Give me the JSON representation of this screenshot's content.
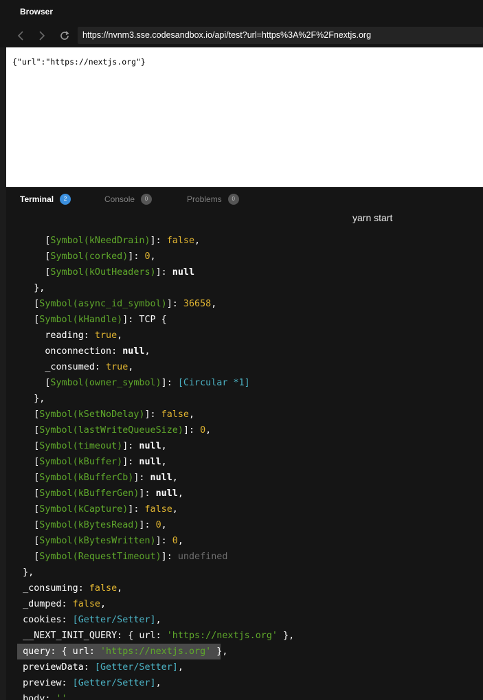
{
  "browser": {
    "title": "Browser",
    "url": "https://nvnm3.sse.codesandbox.io/api/test?url=https%3A%2F%2Fnextjs.org",
    "nav_icons": {
      "back": "arrow-left-icon",
      "forward": "arrow-right-icon",
      "refresh": "refresh-icon"
    }
  },
  "preview": {
    "content": "{\"url\":\"https://nextjs.org\"}"
  },
  "panel": {
    "tabs": [
      {
        "label": "Terminal",
        "badge": "2",
        "active": true
      },
      {
        "label": "Console",
        "badge": "0",
        "active": false
      },
      {
        "label": "Problems",
        "badge": "0",
        "active": false
      }
    ],
    "terminal_name": "yarn start"
  },
  "colors": {
    "symbol": "#5fa82b",
    "number": "#e1b531",
    "getter": "#4cb3c5",
    "undefined": "#6e6e6e",
    "badge_active": "#3b8fde"
  },
  "terminal": {
    "lines": [
      {
        "indent": 6,
        "tokens": [
          {
            "t": "[",
            "c": "plain"
          },
          {
            "t": "Symbol(kNeedDrain)",
            "c": "sym"
          },
          {
            "t": "]: ",
            "c": "plain"
          },
          {
            "t": "false",
            "c": "bool"
          },
          {
            "t": ",",
            "c": "plain"
          }
        ]
      },
      {
        "indent": 6,
        "tokens": [
          {
            "t": "[",
            "c": "plain"
          },
          {
            "t": "Symbol(corked)",
            "c": "sym"
          },
          {
            "t": "]: ",
            "c": "plain"
          },
          {
            "t": "0",
            "c": "num"
          },
          {
            "t": ",",
            "c": "plain"
          }
        ]
      },
      {
        "indent": 6,
        "tokens": [
          {
            "t": "[",
            "c": "plain"
          },
          {
            "t": "Symbol(kOutHeaders)",
            "c": "sym"
          },
          {
            "t": "]: ",
            "c": "plain"
          },
          {
            "t": "null",
            "c": "nul"
          }
        ]
      },
      {
        "indent": 4,
        "tokens": [
          {
            "t": "},",
            "c": "plain"
          }
        ]
      },
      {
        "indent": 4,
        "tokens": [
          {
            "t": "[",
            "c": "plain"
          },
          {
            "t": "Symbol(async_id_symbol)",
            "c": "sym"
          },
          {
            "t": "]: ",
            "c": "plain"
          },
          {
            "t": "36658",
            "c": "num"
          },
          {
            "t": ",",
            "c": "plain"
          }
        ]
      },
      {
        "indent": 4,
        "tokens": [
          {
            "t": "[",
            "c": "plain"
          },
          {
            "t": "Symbol(kHandle)",
            "c": "sym"
          },
          {
            "t": "]: TCP {",
            "c": "plain"
          }
        ]
      },
      {
        "indent": 6,
        "tokens": [
          {
            "t": "reading: ",
            "c": "plain"
          },
          {
            "t": "true",
            "c": "bool"
          },
          {
            "t": ",",
            "c": "plain"
          }
        ]
      },
      {
        "indent": 6,
        "tokens": [
          {
            "t": "onconnection: ",
            "c": "plain"
          },
          {
            "t": "null",
            "c": "nul"
          },
          {
            "t": ",",
            "c": "plain"
          }
        ]
      },
      {
        "indent": 6,
        "tokens": [
          {
            "t": "_consumed: ",
            "c": "plain"
          },
          {
            "t": "true",
            "c": "bool"
          },
          {
            "t": ",",
            "c": "plain"
          }
        ]
      },
      {
        "indent": 6,
        "tokens": [
          {
            "t": "[",
            "c": "plain"
          },
          {
            "t": "Symbol(owner_symbol)",
            "c": "sym"
          },
          {
            "t": "]: ",
            "c": "plain"
          },
          {
            "t": "[Circular *1]",
            "c": "cyan"
          }
        ]
      },
      {
        "indent": 4,
        "tokens": [
          {
            "t": "},",
            "c": "plain"
          }
        ]
      },
      {
        "indent": 4,
        "tokens": [
          {
            "t": "[",
            "c": "plain"
          },
          {
            "t": "Symbol(kSetNoDelay)",
            "c": "sym"
          },
          {
            "t": "]: ",
            "c": "plain"
          },
          {
            "t": "false",
            "c": "bool"
          },
          {
            "t": ",",
            "c": "plain"
          }
        ]
      },
      {
        "indent": 4,
        "tokens": [
          {
            "t": "[",
            "c": "plain"
          },
          {
            "t": "Symbol(lastWriteQueueSize)",
            "c": "sym"
          },
          {
            "t": "]: ",
            "c": "plain"
          },
          {
            "t": "0",
            "c": "num"
          },
          {
            "t": ",",
            "c": "plain"
          }
        ]
      },
      {
        "indent": 4,
        "tokens": [
          {
            "t": "[",
            "c": "plain"
          },
          {
            "t": "Symbol(timeout)",
            "c": "sym"
          },
          {
            "t": "]: ",
            "c": "plain"
          },
          {
            "t": "null",
            "c": "nul"
          },
          {
            "t": ",",
            "c": "plain"
          }
        ]
      },
      {
        "indent": 4,
        "tokens": [
          {
            "t": "[",
            "c": "plain"
          },
          {
            "t": "Symbol(kBuffer)",
            "c": "sym"
          },
          {
            "t": "]: ",
            "c": "plain"
          },
          {
            "t": "null",
            "c": "nul"
          },
          {
            "t": ",",
            "c": "plain"
          }
        ]
      },
      {
        "indent": 4,
        "tokens": [
          {
            "t": "[",
            "c": "plain"
          },
          {
            "t": "Symbol(kBufferCb)",
            "c": "sym"
          },
          {
            "t": "]: ",
            "c": "plain"
          },
          {
            "t": "null",
            "c": "nul"
          },
          {
            "t": ",",
            "c": "plain"
          }
        ]
      },
      {
        "indent": 4,
        "tokens": [
          {
            "t": "[",
            "c": "plain"
          },
          {
            "t": "Symbol(kBufferGen)",
            "c": "sym"
          },
          {
            "t": "]: ",
            "c": "plain"
          },
          {
            "t": "null",
            "c": "nul"
          },
          {
            "t": ",",
            "c": "plain"
          }
        ]
      },
      {
        "indent": 4,
        "tokens": [
          {
            "t": "[",
            "c": "plain"
          },
          {
            "t": "Symbol(kCapture)",
            "c": "sym"
          },
          {
            "t": "]: ",
            "c": "plain"
          },
          {
            "t": "false",
            "c": "bool"
          },
          {
            "t": ",",
            "c": "plain"
          }
        ]
      },
      {
        "indent": 4,
        "tokens": [
          {
            "t": "[",
            "c": "plain"
          },
          {
            "t": "Symbol(kBytesRead)",
            "c": "sym"
          },
          {
            "t": "]: ",
            "c": "plain"
          },
          {
            "t": "0",
            "c": "num"
          },
          {
            "t": ",",
            "c": "plain"
          }
        ]
      },
      {
        "indent": 4,
        "tokens": [
          {
            "t": "[",
            "c": "plain"
          },
          {
            "t": "Symbol(kBytesWritten)",
            "c": "sym"
          },
          {
            "t": "]: ",
            "c": "plain"
          },
          {
            "t": "0",
            "c": "num"
          },
          {
            "t": ",",
            "c": "plain"
          }
        ]
      },
      {
        "indent": 4,
        "tokens": [
          {
            "t": "[",
            "c": "plain"
          },
          {
            "t": "Symbol(RequestTimeout)",
            "c": "sym"
          },
          {
            "t": "]: ",
            "c": "plain"
          },
          {
            "t": "undefined",
            "c": "undef"
          }
        ]
      },
      {
        "indent": 2,
        "tokens": [
          {
            "t": "},",
            "c": "plain"
          }
        ]
      },
      {
        "indent": 2,
        "tokens": [
          {
            "t": "_consuming: ",
            "c": "plain"
          },
          {
            "t": "false",
            "c": "bool"
          },
          {
            "t": ",",
            "c": "plain"
          }
        ]
      },
      {
        "indent": 2,
        "tokens": [
          {
            "t": "_dumped: ",
            "c": "plain"
          },
          {
            "t": "false",
            "c": "bool"
          },
          {
            "t": ",",
            "c": "plain"
          }
        ]
      },
      {
        "indent": 2,
        "tokens": [
          {
            "t": "cookies: ",
            "c": "plain"
          },
          {
            "t": "[Getter/Setter]",
            "c": "cyan"
          },
          {
            "t": ",",
            "c": "plain"
          }
        ]
      },
      {
        "indent": 2,
        "tokens": [
          {
            "t": "__NEXT_INIT_QUERY: { url: ",
            "c": "plain"
          },
          {
            "t": "'https://nextjs.org'",
            "c": "str"
          },
          {
            "t": " },",
            "c": "plain"
          }
        ]
      },
      {
        "indent": 2,
        "highlight": true,
        "tokens": [
          {
            "t": "query: { url: ",
            "c": "plain"
          },
          {
            "t": "'https://nextjs.org'",
            "c": "str"
          },
          {
            "t": " },",
            "c": "plain"
          }
        ]
      },
      {
        "indent": 2,
        "tokens": [
          {
            "t": "previewData: ",
            "c": "plain"
          },
          {
            "t": "[Getter/Setter]",
            "c": "cyan"
          },
          {
            "t": ",",
            "c": "plain"
          }
        ]
      },
      {
        "indent": 2,
        "tokens": [
          {
            "t": "preview: ",
            "c": "plain"
          },
          {
            "t": "[Getter/Setter]",
            "c": "cyan"
          },
          {
            "t": ",",
            "c": "plain"
          }
        ]
      },
      {
        "indent": 2,
        "tokens": [
          {
            "t": "body: ",
            "c": "plain"
          },
          {
            "t": "''",
            "c": "str"
          }
        ]
      }
    ]
  }
}
